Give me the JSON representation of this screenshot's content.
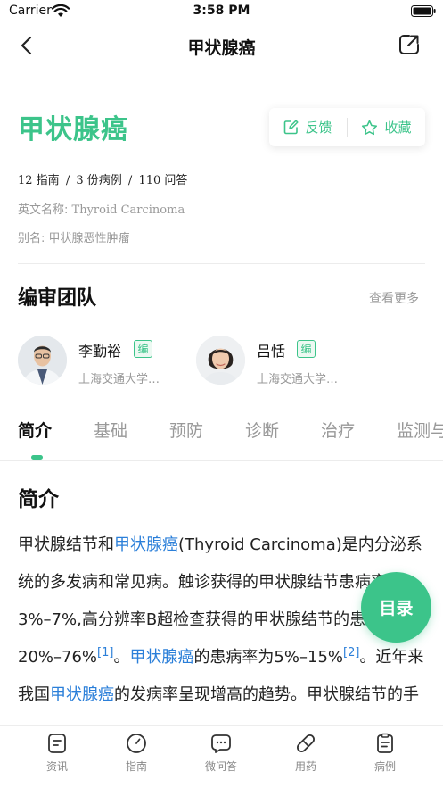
{
  "status_bar": {
    "carrier": "Carrier",
    "time": "3:58 PM"
  },
  "nav": {
    "title": "甲状腺癌"
  },
  "header": {
    "title": "甲状腺癌",
    "feedback_label": "反馈",
    "favorite_label": "收藏",
    "counts": {
      "guides": "12 指南",
      "cases": "3 份病例",
      "qa": "110 问答",
      "separator": "/"
    },
    "english_name_label": "英文名称:",
    "english_name": "Thyroid Carcinoma",
    "alias_label": "别名:",
    "alias": "甲状腺恶性肿瘤"
  },
  "team": {
    "title": "编审团队",
    "more_label": "查看更多",
    "members": [
      {
        "name": "李勤裕",
        "badge": "编",
        "org": "上海交通大学…"
      },
      {
        "name": "吕恬",
        "badge": "编",
        "org": "上海交通大学…"
      }
    ]
  },
  "tabs": [
    "简介",
    "基础",
    "预防",
    "诊断",
    "治疗",
    "监测与"
  ],
  "active_tab": "简介",
  "content": {
    "section_title": "简介",
    "p1": "甲状腺结节和",
    "link1": "甲状腺癌",
    "p2": "(Thyroid Carcinoma)是内分泌系统的多发病和常见病。触诊获得的甲状腺结节患病率为3%–7%,高分辨率B超检查获得的甲状腺结节的患病率为20%–76%",
    "ref1": "[1]",
    "p3": "。",
    "link2": "甲状腺癌",
    "p4": "的患病率为5%–15%",
    "ref2": "[2]",
    "p5": "。近年来我国",
    "link3": "甲状腺癌",
    "p6": "的发病率呈现增高的趋势。甲状腺结节的手"
  },
  "toc_button": "目录",
  "bottom_nav": [
    {
      "label": "资讯",
      "icon": "news-icon"
    },
    {
      "label": "指南",
      "icon": "guide-icon"
    },
    {
      "label": "微问答",
      "icon": "qa-icon"
    },
    {
      "label": "用药",
      "icon": "medicine-icon"
    },
    {
      "label": "病例",
      "icon": "case-icon"
    }
  ],
  "colors": {
    "accent": "#3cc48a",
    "link": "#2b7fd9",
    "muted": "#999999"
  }
}
